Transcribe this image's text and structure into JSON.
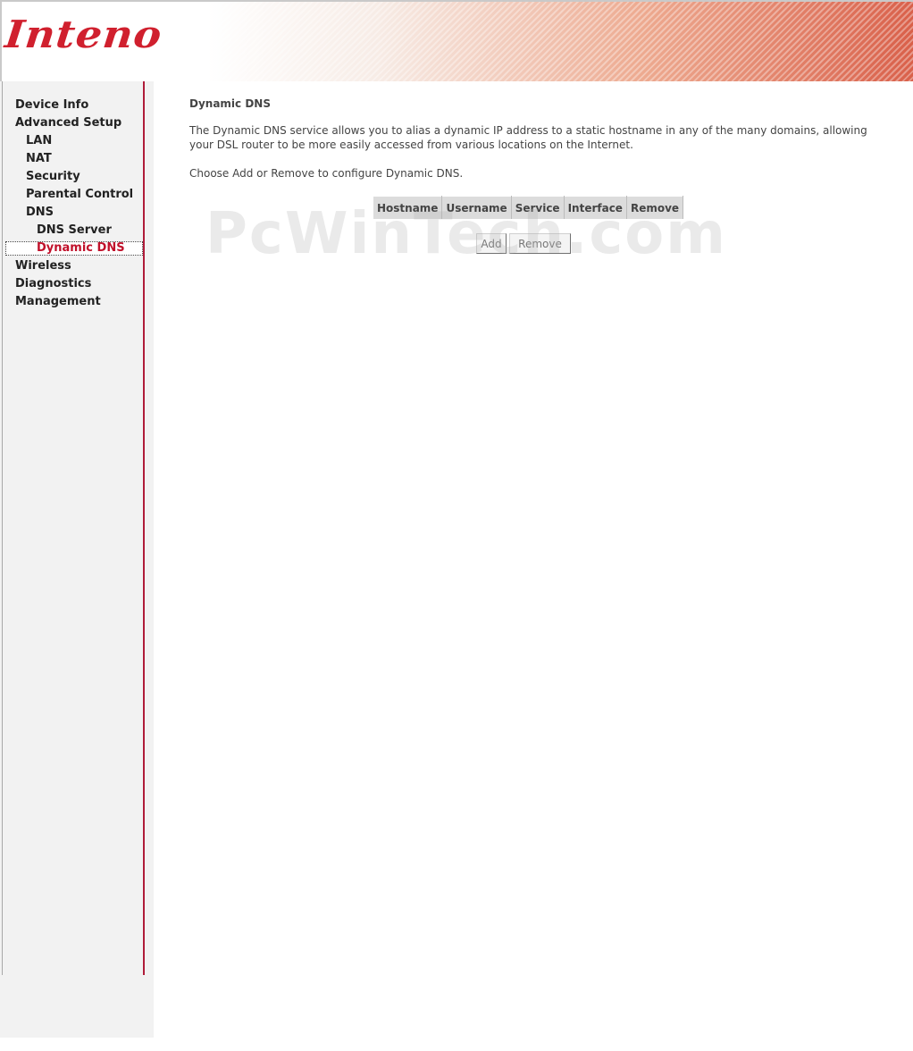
{
  "header": {
    "logo_text": "Inteno"
  },
  "sidebar": {
    "items": [
      {
        "label": "Device Info",
        "level": 1
      },
      {
        "label": "Advanced Setup",
        "level": 1
      },
      {
        "label": "LAN",
        "level": 2
      },
      {
        "label": "NAT",
        "level": 2
      },
      {
        "label": "Security",
        "level": 2
      },
      {
        "label": "Parental Control",
        "level": 2
      },
      {
        "label": "DNS",
        "level": 2
      },
      {
        "label": "DNS Server",
        "level": 3
      },
      {
        "label": "Dynamic DNS",
        "level": 3,
        "active": true
      },
      {
        "label": "Wireless",
        "level": 1
      },
      {
        "label": "Diagnostics",
        "level": 1
      },
      {
        "label": "Management",
        "level": 1
      }
    ],
    "active_color": "#c0102a",
    "border_color": "#b01c3a"
  },
  "main": {
    "title": "Dynamic DNS",
    "description": "The Dynamic DNS service allows you to alias a dynamic IP address to a static hostname in any of the many domains, allowing your DSL router to be more easily accessed from various locations on the Internet.",
    "instruction": "Choose Add or Remove to configure Dynamic DNS.",
    "table": {
      "columns": [
        "Hostname",
        "Username",
        "Service",
        "Interface",
        "Remove"
      ],
      "rows": []
    },
    "buttons": {
      "add_label": "Add",
      "remove_label": "Remove"
    }
  },
  "watermark": "PcWinTech.com"
}
